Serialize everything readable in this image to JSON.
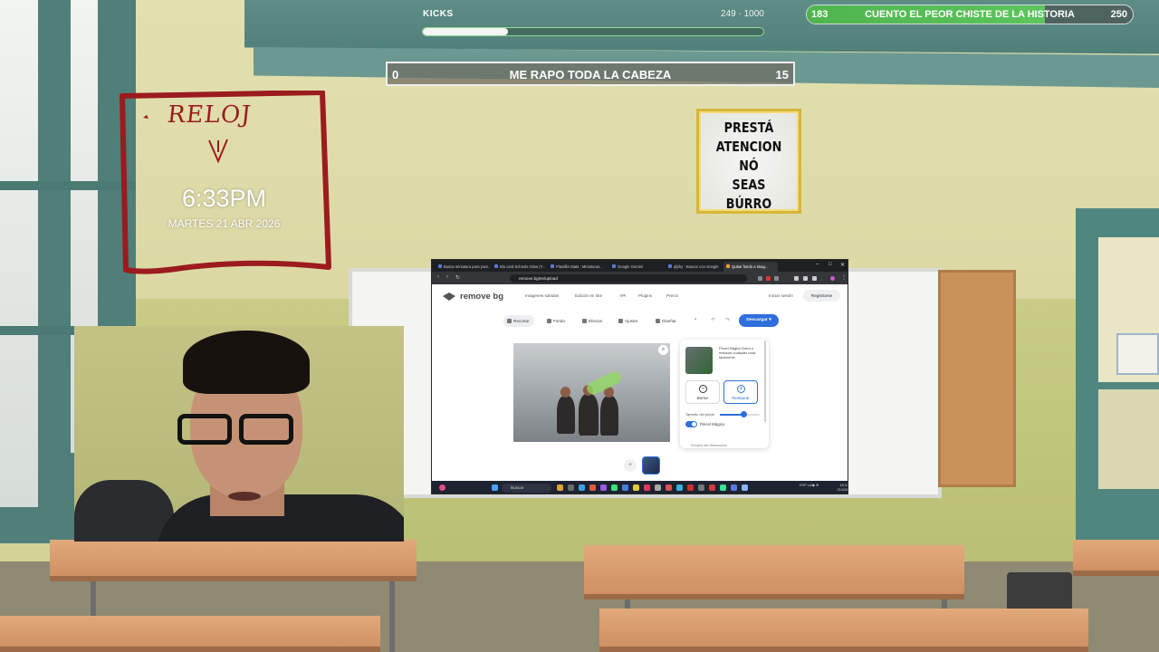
{
  "stream": {
    "kicks_goal": {
      "label": "KICKS",
      "count": "249 · 1000",
      "progress": 0.249
    },
    "top_goal": {
      "left": "183",
      "title": "CUENTO EL PEOR CHISTE DE LA HISTORIA",
      "right": "250",
      "progress": 0.73
    },
    "main_goal": {
      "left": "0",
      "title": "ME RAPO TODA LA CABEZA",
      "right": "15"
    },
    "clock": {
      "note": "RELOJ",
      "time": "6:33PM",
      "date": "MARTES 21 ABR 2026"
    },
    "notice": {
      "lines": [
        "PRESTÁ",
        "ATENCION",
        "NÓ",
        "SEAS",
        "BÚRRO"
      ]
    }
  },
  "browser": {
    "tabs": [
      {
        "label": "Busca miniatura para yout..."
      },
      {
        "label": "Blu card Schools Glow (Y..."
      },
      {
        "label": "Plantilla Stats : Miniaturas..."
      },
      {
        "label": "Google Gemini"
      },
      {
        "label": "qfphy - Buscar con Google"
      },
      {
        "label": "Quitar fondo a imag..."
      }
    ],
    "url": "remove.bg/es/upload",
    "site": {
      "logo": "remove bg",
      "nav": [
        "Imágenes subidas",
        "Edición en lote",
        "API",
        "Plugins",
        "Precio"
      ],
      "login": "Iniciar sesión",
      "register": "Registrarse"
    },
    "editor_tools": [
      "Recortar",
      "Fondo",
      "Efectos",
      "Ajustar",
      "Diseñar"
    ],
    "download": "Descargar",
    "brush_panel": {
      "description": "Pincel Mágico Borra o restaura cualquier cosa fácilmente",
      "erase": "Borrar",
      "restore": "Restaurar",
      "size_label": "Tamaño del pincel",
      "size_value": 0.6,
      "toggle_label": "Pincel Mágico",
      "footer": "Fondos sin distracción"
    },
    "taskbar": {
      "search": "Buscar",
      "lang": "ESP LAA",
      "time": "18:33",
      "date": "21/4/26"
    }
  }
}
